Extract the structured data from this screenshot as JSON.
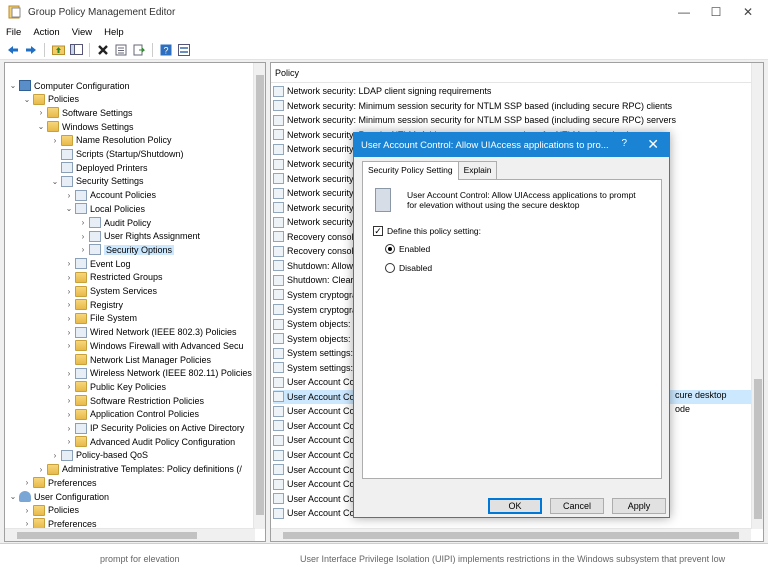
{
  "window": {
    "title": "Group Policy Management Editor",
    "minimize": "—",
    "maximize": "☐",
    "close": "✕"
  },
  "menu": [
    "File",
    "Action",
    "View",
    "Help"
  ],
  "tree": {
    "items": [
      {
        "label": "Computer Configuration",
        "chev": "⌄",
        "icon": "monitor"
      },
      {
        "label": "Policies",
        "chev": "⌄",
        "icon": "folder"
      },
      {
        "label": "Software Settings",
        "chev": "›",
        "icon": "folder"
      },
      {
        "label": "Windows Settings",
        "chev": "⌄",
        "icon": "folder"
      },
      {
        "label": "Name Resolution Policy",
        "chev": "›",
        "icon": "folder"
      },
      {
        "label": "Scripts (Startup/Shutdown)",
        "chev": "",
        "icon": "doc"
      },
      {
        "label": "Deployed Printers",
        "chev": "",
        "icon": "doc"
      },
      {
        "label": "Security Settings",
        "chev": "⌄",
        "icon": "doc"
      },
      {
        "label": "Account Policies",
        "chev": "›",
        "icon": "doc"
      },
      {
        "label": "Local Policies",
        "chev": "⌄",
        "icon": "doc"
      },
      {
        "label": "Audit Policy",
        "chev": "›",
        "icon": "doc"
      },
      {
        "label": "User Rights Assignment",
        "chev": "›",
        "icon": "doc"
      },
      {
        "label": "Security Options",
        "chev": "›",
        "icon": "doc"
      },
      {
        "label": "Event Log",
        "chev": "›",
        "icon": "doc"
      },
      {
        "label": "Restricted Groups",
        "chev": "›",
        "icon": "folder"
      },
      {
        "label": "System Services",
        "chev": "›",
        "icon": "folder"
      },
      {
        "label": "Registry",
        "chev": "›",
        "icon": "folder"
      },
      {
        "label": "File System",
        "chev": "›",
        "icon": "folder"
      },
      {
        "label": "Wired Network (IEEE 802.3) Policies",
        "chev": "›",
        "icon": "doc"
      },
      {
        "label": "Windows Firewall with Advanced Secu",
        "chev": "›",
        "icon": "folder"
      },
      {
        "label": "Network List Manager Policies",
        "chev": "",
        "icon": "folder"
      },
      {
        "label": "Wireless Network (IEEE 802.11) Policies",
        "chev": "›",
        "icon": "doc"
      },
      {
        "label": "Public Key Policies",
        "chev": "›",
        "icon": "folder"
      },
      {
        "label": "Software Restriction Policies",
        "chev": "›",
        "icon": "folder"
      },
      {
        "label": "Application Control Policies",
        "chev": "›",
        "icon": "folder"
      },
      {
        "label": "IP Security Policies on Active Directory",
        "chev": "›",
        "icon": "doc"
      },
      {
        "label": "Advanced Audit Policy Configuration",
        "chev": "›",
        "icon": "folder"
      },
      {
        "label": "Policy-based QoS",
        "chev": "›",
        "icon": "doc"
      },
      {
        "label": "Administrative Templates: Policy definitions (/",
        "chev": "›",
        "icon": "folder"
      },
      {
        "label": "Preferences",
        "chev": "›",
        "icon": "folder"
      },
      {
        "label": "User Configuration",
        "chev": "⌄",
        "icon": "users"
      },
      {
        "label": "Policies",
        "chev": "›",
        "icon": "folder"
      },
      {
        "label": "Preferences",
        "chev": "›",
        "icon": "folder"
      }
    ]
  },
  "list": {
    "header": "Policy",
    "rows": [
      "Network security: LDAP client signing requirements",
      "Network security: Minimum session security for NTLM SSP based (including secure RPC) clients",
      "Network security: Minimum session security for NTLM SSP based (including secure RPC) servers",
      "Network security: Restrict NTLM: Add remote server exceptions for NTLM authentication",
      "Network security",
      "Network security",
      "Network security",
      "Network security",
      "Network security",
      "Network security",
      "Recovery console",
      "Recovery console",
      "Shutdown: Allow",
      "Shutdown: Clear",
      "System cryptogra",
      "System cryptogra",
      "System objects: R",
      "System objects: S",
      "System settings: ",
      "System settings: ",
      "User Account Co",
      "User Account Co",
      "User Account Co",
      "User Account Co",
      "User Account Co",
      "User Account Co",
      "User Account Co",
      "User Account Co",
      "User Account Co",
      "User Account Co"
    ],
    "right_fragment_1": "cure desktop",
    "right_fragment_2": "ode"
  },
  "status": {
    "left": "prompt for elevation",
    "right": "User Interface Privilege Isolation (UIPI) implements restrictions in the Windows subsystem that prevent low"
  },
  "dialog": {
    "title": "User Account Control: Allow UIAccess applications to pro...",
    "help": "?",
    "close": "✕",
    "tabs": [
      "Security Policy Setting",
      "Explain"
    ],
    "description": "User Account Control: Allow UIAccess applications to prompt for elevation without using the secure desktop",
    "define_label": "Define this policy setting:",
    "define_checked": "✓",
    "enabled_label": "Enabled",
    "disabled_label": "Disabled",
    "ok": "OK",
    "cancel": "Cancel",
    "apply": "Apply"
  }
}
